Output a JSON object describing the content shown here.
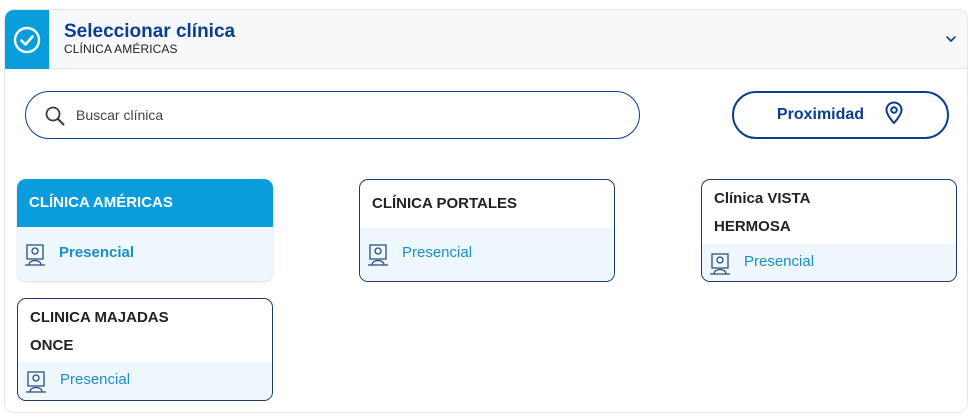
{
  "header": {
    "title": "Seleccionar clínica",
    "subtitle": "CLÍNICA AMÉRICAS"
  },
  "search": {
    "placeholder": "Buscar clínica",
    "value": ""
  },
  "proximity": {
    "label": "Proximidad"
  },
  "clinics": [
    {
      "name": "CLÍNICA AMÉRICAS",
      "mode": "Presencial",
      "selected": true
    },
    {
      "name": "CLÍNICA PORTALES",
      "mode": "Presencial",
      "selected": false
    },
    {
      "name": "Clínica VISTA HERMOSA",
      "line1": "Clínica VISTA",
      "line2": "HERMOSA",
      "mode": "Presencial",
      "selected": false
    },
    {
      "name": "CLINICA MAJADAS ONCE",
      "line1": "CLINICA MAJADAS",
      "line2": "ONCE",
      "mode": "Presencial",
      "selected": false
    }
  ],
  "colors": {
    "accent": "#0a9ddb",
    "brand_navy": "#0b3d91",
    "footer_bg": "#eef7fc",
    "link_blue": "#1b8fc7"
  },
  "icons": {
    "header": "check-circle-icon",
    "collapse": "chevron-down-icon",
    "search": "search-icon",
    "proximity": "location-pin-icon",
    "mode": "in-person-icon"
  }
}
